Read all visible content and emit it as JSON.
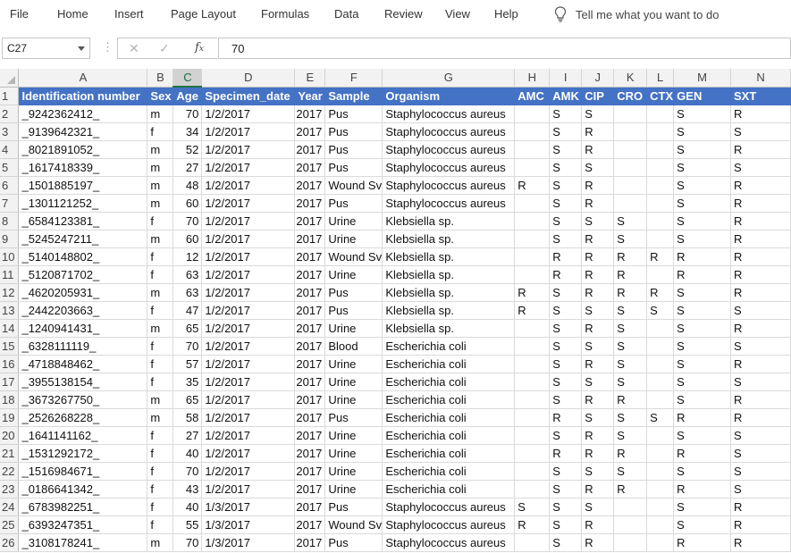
{
  "ribbon": {
    "tabs": [
      "File",
      "Home",
      "Insert",
      "Page Layout",
      "Formulas",
      "Data",
      "Review",
      "View",
      "Help"
    ],
    "tell_me": "Tell me what you want to do"
  },
  "formula_bar": {
    "name_box": "C27",
    "value": "70"
  },
  "sheet": {
    "columns": [
      "A",
      "B",
      "C",
      "D",
      "E",
      "F",
      "G",
      "H",
      "I",
      "J",
      "K",
      "L",
      "M",
      "N"
    ],
    "selected_column": "C",
    "selected_row": 27,
    "header": [
      "Identification number",
      "Sex",
      "Age",
      "Specimen_date",
      "Year",
      "Sample",
      "Organism",
      "AMC",
      "AMK",
      "CIP",
      "CRO",
      "CTX",
      "GEN",
      "SXT"
    ],
    "rows": [
      [
        "_9242362412_",
        "m",
        "70",
        "1/2/2017",
        "2017",
        "Pus",
        "Staphylococcus aureus",
        "",
        "S",
        "S",
        "",
        "",
        "S",
        "R"
      ],
      [
        "_9139642321_",
        "f",
        "34",
        "1/2/2017",
        "2017",
        "Pus",
        "Staphylococcus aureus",
        "",
        "S",
        "R",
        "",
        "",
        "S",
        "S"
      ],
      [
        "_8021891052_",
        "m",
        "52",
        "1/2/2017",
        "2017",
        "Pus",
        "Staphylococcus aureus",
        "",
        "S",
        "R",
        "",
        "",
        "S",
        "R"
      ],
      [
        "_1617418339_",
        "m",
        "27",
        "1/2/2017",
        "2017",
        "Pus",
        "Staphylococcus aureus",
        "",
        "S",
        "S",
        "",
        "",
        "S",
        "S"
      ],
      [
        "_1501885197_",
        "m",
        "48",
        "1/2/2017",
        "2017",
        "Wound Sv",
        "Staphylococcus aureus",
        "R",
        "S",
        "R",
        "",
        "",
        "S",
        "R"
      ],
      [
        "_1301121252_",
        "m",
        "60",
        "1/2/2017",
        "2017",
        "Pus",
        "Staphylococcus aureus",
        "",
        "S",
        "R",
        "",
        "",
        "S",
        "R"
      ],
      [
        "_6584123381_",
        "f",
        "70",
        "1/2/2017",
        "2017",
        "Urine",
        "Klebsiella sp.",
        "",
        "S",
        "S",
        "S",
        "",
        "S",
        "R"
      ],
      [
        "_5245247211_",
        "m",
        "60",
        "1/2/2017",
        "2017",
        "Urine",
        "Klebsiella sp.",
        "",
        "S",
        "R",
        "S",
        "",
        "S",
        "R"
      ],
      [
        "_5140148802_",
        "f",
        "12",
        "1/2/2017",
        "2017",
        "Wound Sv",
        "Klebsiella sp.",
        "",
        "R",
        "R",
        "R",
        "R",
        "R",
        "R"
      ],
      [
        "_5120871702_",
        "f",
        "63",
        "1/2/2017",
        "2017",
        "Urine",
        "Klebsiella sp.",
        "",
        "R",
        "R",
        "R",
        "",
        "R",
        "R"
      ],
      [
        "_4620205931_",
        "m",
        "63",
        "1/2/2017",
        "2017",
        "Pus",
        "Klebsiella sp.",
        "R",
        "S",
        "R",
        "R",
        "R",
        "S",
        "R"
      ],
      [
        "_2442203663_",
        "f",
        "47",
        "1/2/2017",
        "2017",
        "Pus",
        "Klebsiella sp.",
        "R",
        "S",
        "S",
        "S",
        "S",
        "S",
        "S"
      ],
      [
        "_1240941431_",
        "m",
        "65",
        "1/2/2017",
        "2017",
        "Urine",
        "Klebsiella sp.",
        "",
        "S",
        "R",
        "S",
        "",
        "S",
        "R"
      ],
      [
        "_6328111119_",
        "f",
        "70",
        "1/2/2017",
        "2017",
        "Blood",
        "Escherichia coli",
        "",
        "S",
        "S",
        "S",
        "",
        "S",
        "S"
      ],
      [
        "_4718848462_",
        "f",
        "57",
        "1/2/2017",
        "2017",
        "Urine",
        "Escherichia coli",
        "",
        "S",
        "R",
        "S",
        "",
        "S",
        "R"
      ],
      [
        "_3955138154_",
        "f",
        "35",
        "1/2/2017",
        "2017",
        "Urine",
        "Escherichia coli",
        "",
        "S",
        "S",
        "S",
        "",
        "S",
        "S"
      ],
      [
        "_3673267750_",
        "m",
        "65",
        "1/2/2017",
        "2017",
        "Urine",
        "Escherichia coli",
        "",
        "S",
        "R",
        "R",
        "",
        "S",
        "R"
      ],
      [
        "_2526268228_",
        "m",
        "58",
        "1/2/2017",
        "2017",
        "Pus",
        "Escherichia coli",
        "",
        "R",
        "S",
        "S",
        "S",
        "R",
        "R"
      ],
      [
        "_1641141162_",
        "f",
        "27",
        "1/2/2017",
        "2017",
        "Urine",
        "Escherichia coli",
        "",
        "S",
        "R",
        "S",
        "",
        "S",
        "S"
      ],
      [
        "_1531292172_",
        "f",
        "40",
        "1/2/2017",
        "2017",
        "Urine",
        "Escherichia coli",
        "",
        "R",
        "R",
        "R",
        "",
        "R",
        "S"
      ],
      [
        "_1516984671_",
        "f",
        "70",
        "1/2/2017",
        "2017",
        "Urine",
        "Escherichia coli",
        "",
        "S",
        "S",
        "S",
        "",
        "S",
        "S"
      ],
      [
        "_0186641342_",
        "f",
        "43",
        "1/2/2017",
        "2017",
        "Urine",
        "Escherichia coli",
        "",
        "S",
        "R",
        "R",
        "",
        "R",
        "S"
      ],
      [
        "_6783982251_",
        "f",
        "40",
        "1/3/2017",
        "2017",
        "Pus",
        "Staphylococcus aureus",
        "S",
        "S",
        "S",
        "",
        "",
        "S",
        "R"
      ],
      [
        "_6393247351_",
        "f",
        "55",
        "1/3/2017",
        "2017",
        "Wound Sv",
        "Staphylococcus aureus",
        "R",
        "S",
        "R",
        "",
        "",
        "S",
        "R"
      ],
      [
        "_3108178241_",
        "m",
        "70",
        "1/3/2017",
        "2017",
        "Pus",
        "Staphylococcus aureus",
        "",
        "S",
        "R",
        "",
        "",
        "R",
        "R"
      ]
    ],
    "colors": {
      "header_fill": "#4472c4",
      "header_text": "#ffffff",
      "selection": "#217346",
      "heading_bg": "#f2f2f2"
    }
  }
}
